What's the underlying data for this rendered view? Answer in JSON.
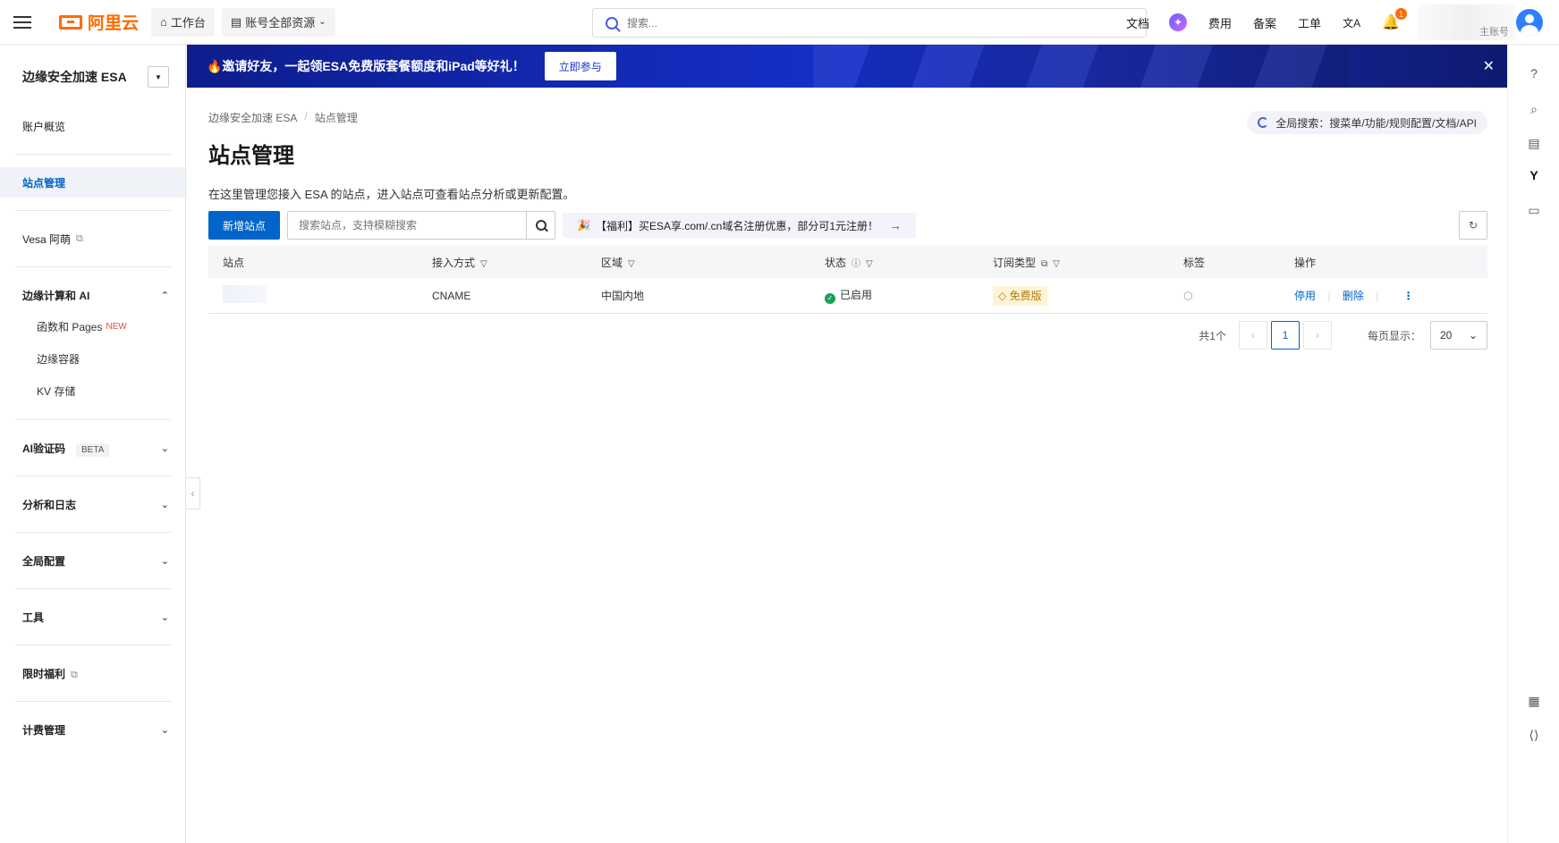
{
  "topbar": {
    "logo_text": "阿里云",
    "workbench": "工作台",
    "resources": "账号全部资源",
    "search_placeholder": "搜索...",
    "links": [
      "文档",
      "费用",
      "备案",
      "工单"
    ],
    "lang_icon": "文A",
    "notif_count": "1",
    "account_label": "主账号"
  },
  "sidebar": {
    "product": "边缘安全加速 ESA",
    "overview": "账户概览",
    "site_mgmt": "站点管理",
    "vesa": "Vesa 阿萌",
    "edge_group": "边缘计算和 AI",
    "edge_items": [
      "函数和 Pages",
      "边缘容器",
      "KV 存储"
    ],
    "new_tag": "NEW",
    "ai_captcha": "AI验证码",
    "beta_tag": "BETA",
    "analytics": "分析和日志",
    "global_config": "全局配置",
    "tools": "工具",
    "benefits": "限时福利",
    "billing": "计费管理"
  },
  "banner": {
    "text": "🔥邀请好友，一起领ESA免费版套餐额度和iPad等好礼！",
    "button": "立即参与"
  },
  "breadcrumb": [
    "边缘安全加速 ESA",
    "站点管理"
  ],
  "global_search": "全局搜索：搜菜单/功能/规则配置/文档/API",
  "page": {
    "title": "站点管理",
    "description": "在这里管理您接入 ESA 的站点，进入站点可查看站点分析或更新配置。",
    "add_button": "新增站点",
    "search_placeholder": "搜索站点，支持模糊搜索",
    "promo": "【福利】买ESA享.com/.cn域名注册优惠，部分可1元注册！"
  },
  "table": {
    "headers": [
      "站点",
      "接入方式",
      "区域",
      "状态",
      "订阅类型",
      "标签",
      "操作"
    ],
    "rows": [
      {
        "access": "CNAME",
        "region": "中国内地",
        "status": "已启用",
        "plan": "免费版",
        "actions": [
          "停用",
          "删除"
        ]
      }
    ]
  },
  "pager": {
    "total": "共1个",
    "page": "1",
    "per_page_label": "每页显示：",
    "per_page": "20"
  },
  "colors": {
    "primary": "#0064c8",
    "brand": "#ff6a00",
    "success": "#18a058"
  }
}
